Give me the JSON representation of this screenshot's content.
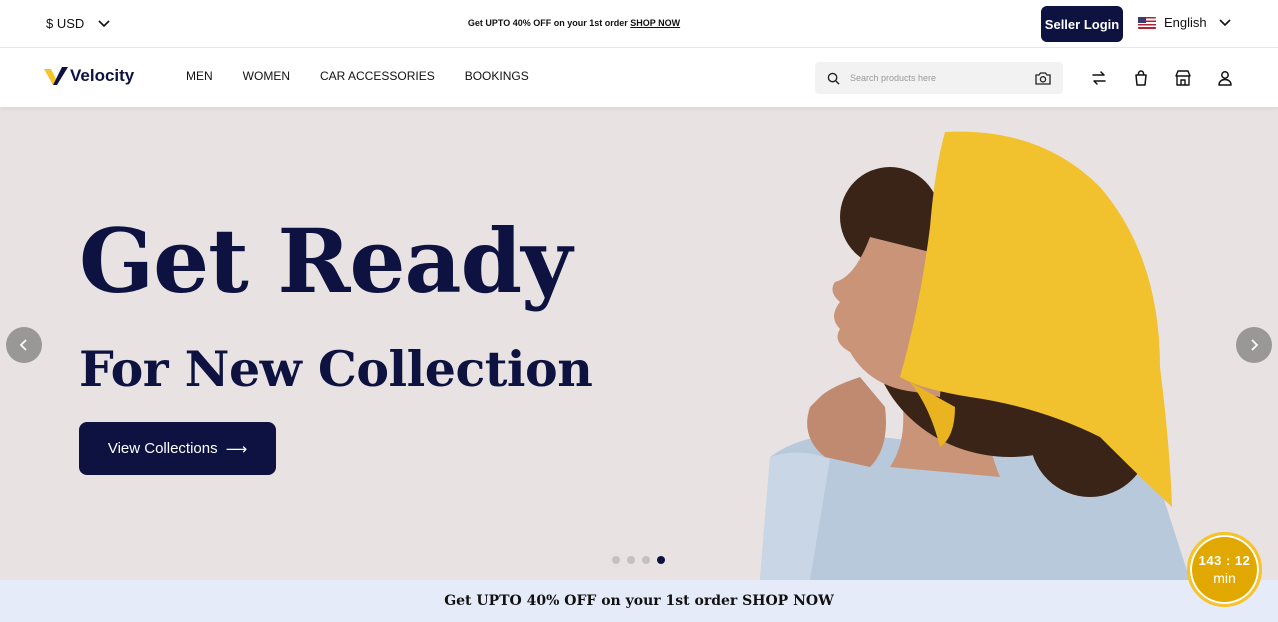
{
  "topbar": {
    "currency": "$ USD",
    "promo_text": "Get UPTO 40% OFF on your 1st order",
    "promo_link": "SHOP NOW",
    "seller_login": "Seller Login",
    "language": "English"
  },
  "nav": {
    "brand": "Velocity",
    "menu": [
      "MEN",
      "WOMEN",
      "CAR ACCESSORIES",
      "BOOKINGS"
    ],
    "search_placeholder": "Search products here",
    "icons": [
      "compare-icon",
      "cart-icon",
      "store-icon",
      "user-icon"
    ]
  },
  "hero": {
    "title": "Get Ready",
    "subtitle": "For New Collection",
    "cta": "View Collections",
    "cta_arrow": "⟶",
    "slides": 4,
    "active_slide": 4
  },
  "promo_bottom": {
    "text": "Get UPTO 40% OFF on your 1st order SHOP NOW"
  },
  "timer": {
    "value": "143 : 12",
    "unit": "min"
  },
  "colors": {
    "navy": "#0d1240",
    "gold": "#f6c32a",
    "hero_bg": "#e8e3e2",
    "promo_bg": "#e6ebf9"
  }
}
